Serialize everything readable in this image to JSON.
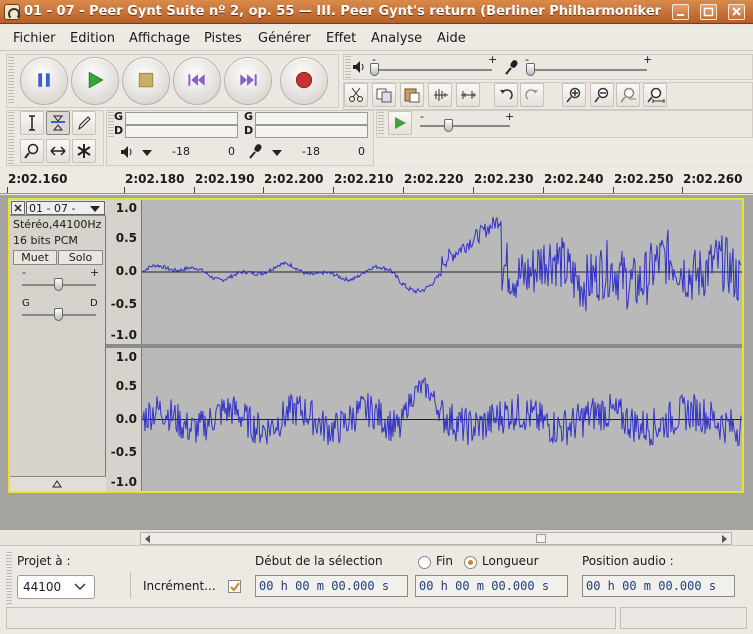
{
  "window": {
    "title": "01 - 07 - Peer Gynt Suite nº 2, op. 55 — III. Peer Gynt's return (Berliner Philharmoniker",
    "buttons": [
      "minimize",
      "maximize",
      "close"
    ]
  },
  "menu": [
    "Fichier",
    "Edition",
    "Affichage",
    "Pistes",
    "Générer",
    "Effet",
    "Analyse",
    "Aide"
  ],
  "meter": {
    "left_label": "G",
    "right_label": "D",
    "play_db": "-18",
    "play_zero": "0",
    "rec_db": "-18",
    "rec_zero": "0"
  },
  "ruler": {
    "labels": [
      "2:02.160",
      "2:02.180",
      "2:02.190",
      "2:02.200",
      "2:02.210",
      "2:02.220",
      "2:02.230",
      "2:02.240",
      "2:02.250",
      "2:02.260"
    ]
  },
  "track": {
    "name": "01 - 07 -",
    "format": "Stéréo,44100Hz",
    "bits": "16 bits PCM",
    "mute_label": "Muet",
    "solo_label": "Solo",
    "gain_minus": "-",
    "gain_plus": "+",
    "pan_left": "G",
    "pan_right": "D",
    "scale_top": [
      "1.0",
      "0.5",
      "0.0",
      "-0.5",
      "-1.0"
    ],
    "scale_bottom": [
      "1.0",
      "0.5",
      "0.0",
      "-0.5",
      "-1.0"
    ]
  },
  "bottom": {
    "project_rate_label": "Projet à :",
    "project_rate_value": "44100",
    "snap_label": "Incrément...",
    "snap_checked": true,
    "selection_label": "Début de la sélection",
    "end_label": "Fin",
    "length_label": "Longueur",
    "length_selected": true,
    "audio_position_label": "Position audio :",
    "sel_start": "00 h 00 m 00.000 s",
    "sel_length": "00 h 00 m 00.000 s",
    "audio_position": "00 h 00 m 00.000 s"
  },
  "colors": {
    "title_bar": "#c97440",
    "waveform": "#3232c8",
    "track_border": "#e8e42d",
    "track_bg": "#b9b9b9"
  }
}
